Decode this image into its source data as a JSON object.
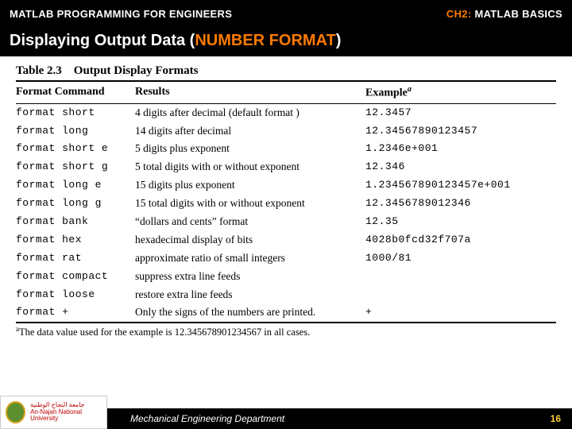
{
  "header": {
    "left": "MATLAB PROGRAMMING FOR ENGINEERS",
    "chapter_tag": "CH2:",
    "right": "MATLAB BASICS"
  },
  "subtitle": {
    "prefix": "Displaying Output Data (",
    "emph": "NUMBER FORMAT",
    "suffix": ")"
  },
  "table": {
    "caption": "Table 2.3 Output Display Formats",
    "col_cmd": "Format Command",
    "col_res": "Results",
    "col_ex": "Example",
    "col_ex_sup": "a",
    "rows": [
      {
        "cmd": "format short",
        "res": "4 digits after decimal (default format )",
        "ex": "12.3457"
      },
      {
        "cmd": "format long",
        "res": "14 digits after decimal",
        "ex": "12.34567890123457"
      },
      {
        "cmd": "format short e",
        "res": "5 digits plus exponent",
        "ex": "1.2346e+001"
      },
      {
        "cmd": "format short g",
        "res": "5 total digits with or without exponent",
        "ex": "12.346"
      },
      {
        "cmd": "format long e",
        "res": "15 digits plus exponent",
        "ex": "1.234567890123457e+001"
      },
      {
        "cmd": "format long g",
        "res": "15 total digits with or without exponent",
        "ex": "12.3456789012346"
      },
      {
        "cmd": "format bank",
        "res": "“dollars and cents” format",
        "ex": "12.35"
      },
      {
        "cmd": "format hex",
        "res": "hexadecimal display of bits",
        "ex": "4028b0fcd32f707a"
      },
      {
        "cmd": "format rat",
        "res": "approximate ratio of small integers",
        "ex": "1000/81"
      },
      {
        "cmd": "format compact",
        "res": "suppress extra line feeds",
        "ex": ""
      },
      {
        "cmd": "format loose",
        "res": "restore extra line feeds",
        "ex": ""
      },
      {
        "cmd": "format +",
        "res": "Only the signs of the numbers are printed.",
        "ex": "+"
      }
    ],
    "footnote_sup": "a",
    "footnote": "The data value used for the example is 12.345678901234567 in all cases."
  },
  "footer": {
    "uni_ar": "جامعة النجاح الوطنية",
    "uni_en": "An-Najah National University",
    "dept": "Mechanical Engineering Department",
    "page": "16"
  }
}
